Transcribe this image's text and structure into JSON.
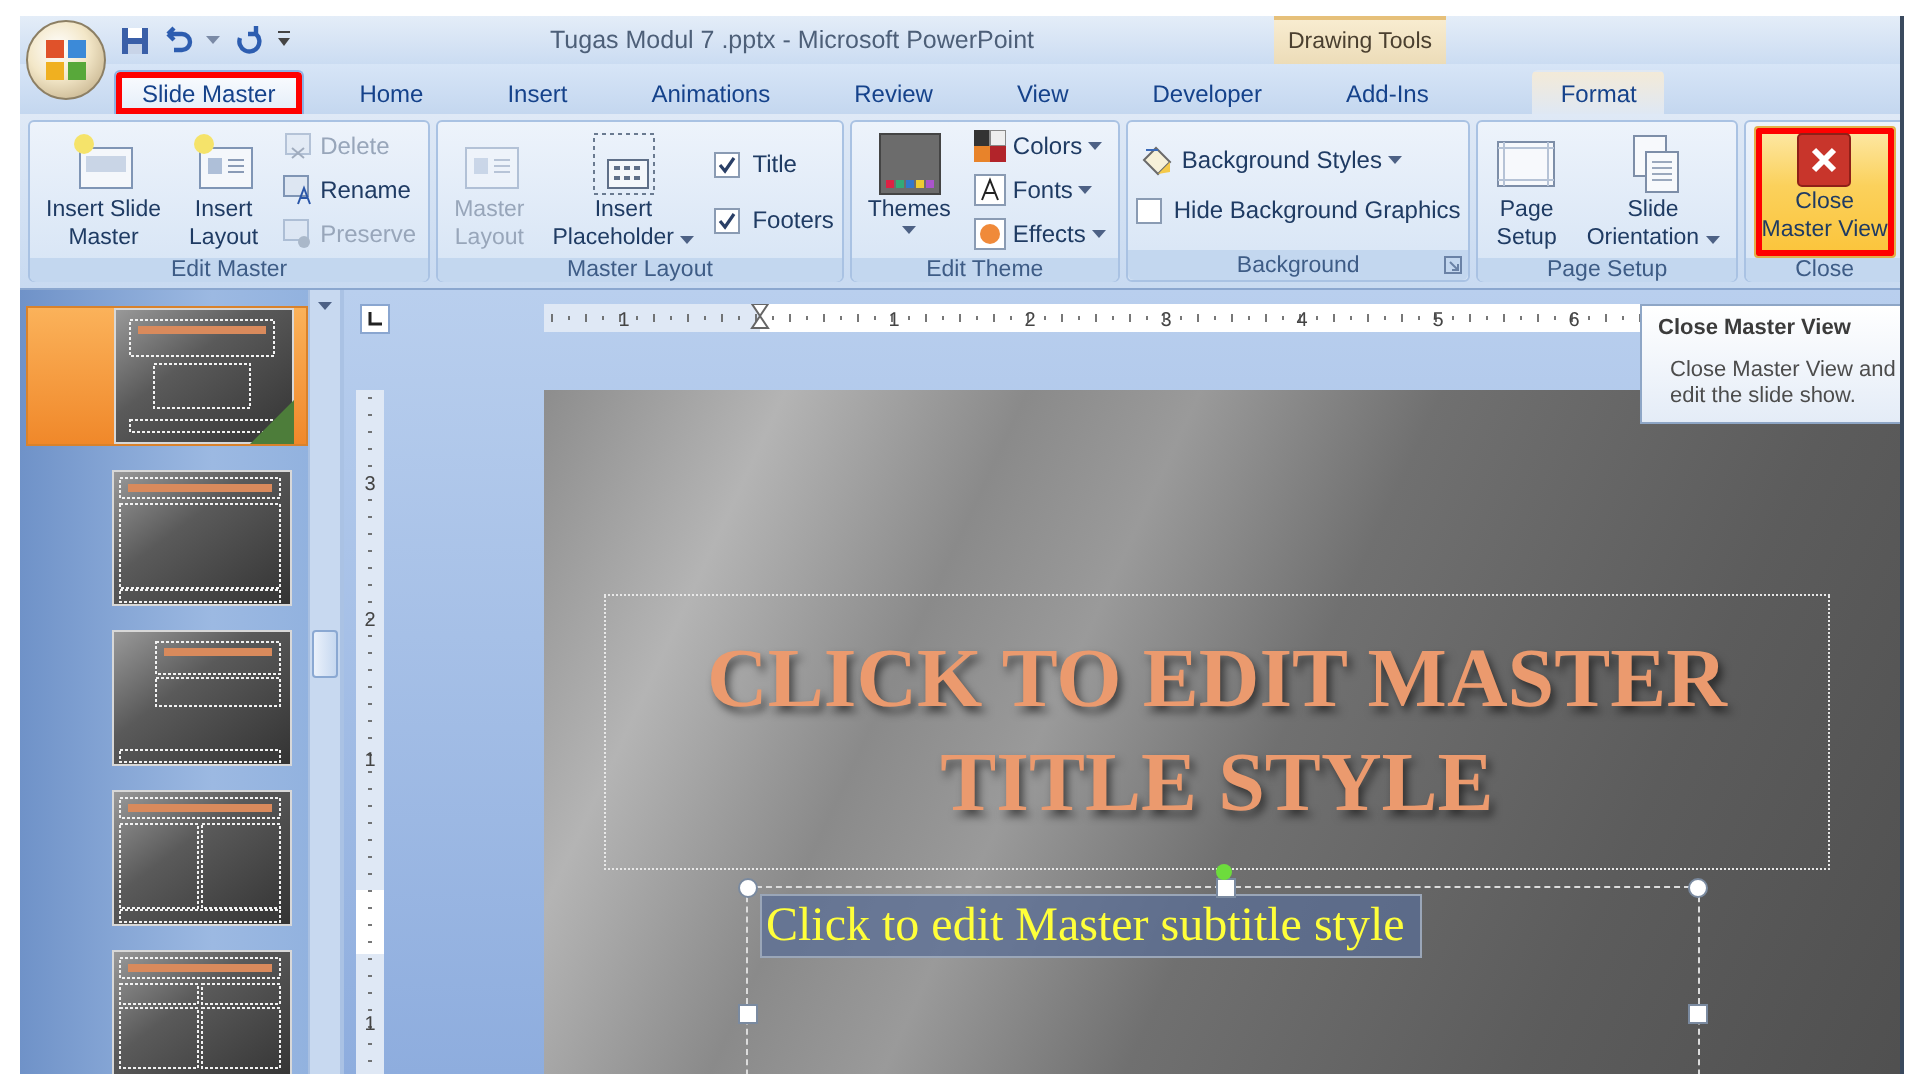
{
  "window": {
    "title": "Tugas Modul 7 .pptx - Microsoft PowerPoint",
    "contextual_group": "Drawing Tools"
  },
  "tabs": [
    {
      "label": "Slide Master",
      "selected": true,
      "highlighted": true,
      "kind": "normal"
    },
    {
      "label": "Home",
      "selected": false,
      "highlighted": false,
      "kind": "normal"
    },
    {
      "label": "Insert",
      "selected": false,
      "highlighted": false,
      "kind": "normal"
    },
    {
      "label": "Animations",
      "selected": false,
      "highlighted": false,
      "kind": "normal"
    },
    {
      "label": "Review",
      "selected": false,
      "highlighted": false,
      "kind": "normal"
    },
    {
      "label": "View",
      "selected": false,
      "highlighted": false,
      "kind": "normal"
    },
    {
      "label": "Developer",
      "selected": false,
      "highlighted": false,
      "kind": "normal"
    },
    {
      "label": "Add-Ins",
      "selected": false,
      "highlighted": false,
      "kind": "normal"
    },
    {
      "label": "Format",
      "selected": false,
      "highlighted": false,
      "kind": "contextual"
    }
  ],
  "ribbon_groups": [
    {
      "label": "Edit Master",
      "launcher": false,
      "columns": [
        [
          {
            "kind": "large",
            "lines": [
              "Insert Slide",
              "Master"
            ],
            "disabled": false,
            "dropdown": false,
            "hovered": false,
            "highlighted": false
          }
        ],
        [
          {
            "kind": "large",
            "lines": [
              "Insert",
              "Layout"
            ],
            "disabled": false,
            "dropdown": false,
            "hovered": false,
            "highlighted": false
          }
        ],
        [
          {
            "kind": "small",
            "label": "Delete",
            "disabled": true,
            "dropdown": false
          },
          {
            "kind": "small",
            "label": "Rename",
            "disabled": false,
            "dropdown": false
          },
          {
            "kind": "small",
            "label": "Preserve",
            "disabled": true,
            "dropdown": false
          }
        ]
      ]
    },
    {
      "label": "Master Layout",
      "launcher": false,
      "columns": [
        [
          {
            "kind": "large",
            "lines": [
              "Master",
              "Layout"
            ],
            "disabled": true,
            "dropdown": false,
            "hovered": false,
            "highlighted": false
          }
        ],
        [
          {
            "kind": "large",
            "lines": [
              "Insert",
              "Placeholder"
            ],
            "disabled": false,
            "dropdown": true,
            "hovered": false,
            "highlighted": false
          }
        ],
        [
          {
            "kind": "checkbox",
            "label": "Title",
            "checked": true
          },
          {
            "kind": "checkbox",
            "label": "Footers",
            "checked": true
          }
        ]
      ]
    },
    {
      "label": "Edit Theme",
      "launcher": false,
      "columns": [
        [
          {
            "kind": "large",
            "lines": [
              "Themes"
            ],
            "disabled": false,
            "dropdown": true,
            "hovered": false,
            "highlighted": false
          }
        ],
        [
          {
            "kind": "small",
            "label": "Colors",
            "disabled": false,
            "dropdown": true
          },
          {
            "kind": "small",
            "label": "Fonts",
            "disabled": false,
            "dropdown": true
          },
          {
            "kind": "small",
            "label": "Effects",
            "disabled": false,
            "dropdown": true
          }
        ]
      ]
    },
    {
      "label": "Background",
      "launcher": true,
      "columns": [
        [
          {
            "kind": "small",
            "label": "Background Styles",
            "disabled": false,
            "dropdown": true
          },
          {
            "kind": "checkbox",
            "label": "Hide Background Graphics",
            "checked": false
          }
        ]
      ]
    },
    {
      "label": "Page Setup",
      "launcher": false,
      "columns": [
        [
          {
            "kind": "large",
            "lines": [
              "Page",
              "Setup"
            ],
            "disabled": false,
            "dropdown": false,
            "hovered": false,
            "highlighted": false
          }
        ],
        [
          {
            "kind": "large",
            "lines": [
              "Slide",
              "Orientation"
            ],
            "disabled": false,
            "dropdown": true,
            "hovered": false,
            "highlighted": false
          }
        ]
      ]
    },
    {
      "label": "Close",
      "launcher": false,
      "columns": [
        [
          {
            "kind": "large",
            "lines": [
              "Close",
              "Master View"
            ],
            "disabled": false,
            "dropdown": false,
            "hovered": true,
            "highlighted": true
          }
        ]
      ]
    }
  ],
  "slide_thumbnails": [
    {
      "selected": true
    },
    {
      "selected": false
    },
    {
      "selected": false
    },
    {
      "selected": false
    },
    {
      "selected": false
    }
  ],
  "horizontal_ruler": [
    "1",
    "1",
    "2",
    "3",
    "4",
    "5",
    "6"
  ],
  "vertical_ruler": [
    "3",
    "2",
    "1",
    "1"
  ],
  "slide": {
    "title": "CLICK TO EDIT MASTER TITLE STYLE",
    "subtitle": "Click to edit Master subtitle style"
  },
  "tooltip": {
    "title": "Close Master View",
    "body": "Close Master View and edit the slide show."
  }
}
